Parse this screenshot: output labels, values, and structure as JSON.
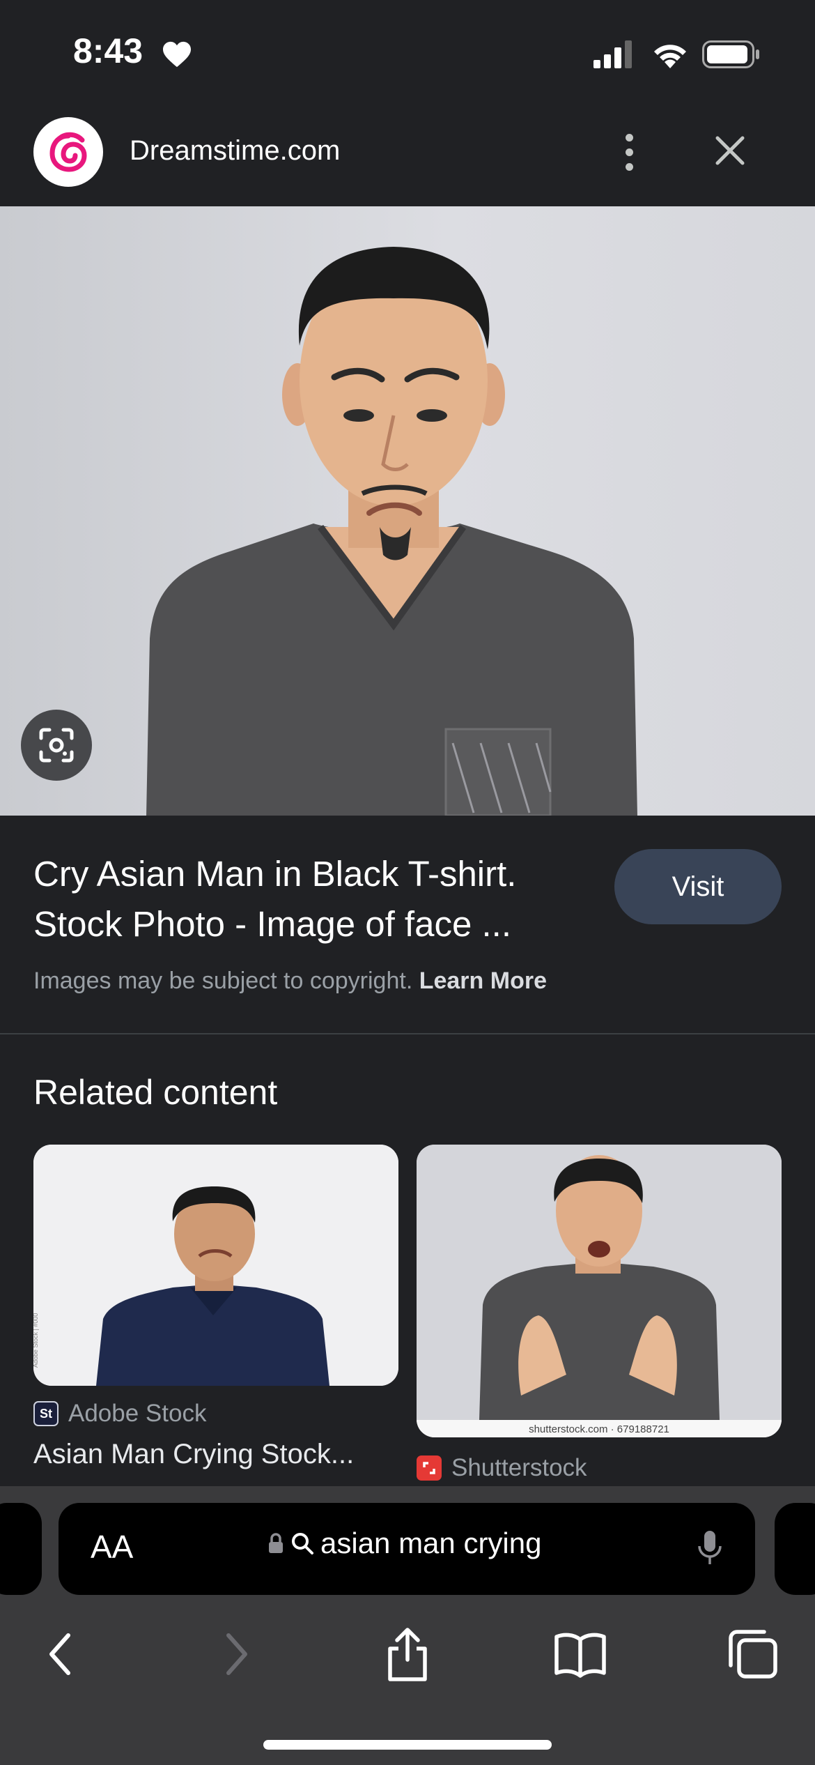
{
  "status_bar": {
    "time": "8:43"
  },
  "site": {
    "name": "Dreamstime.com"
  },
  "result": {
    "title": "Cry Asian Man in Black T-shirt. Stock Photo - Image of face ...",
    "visit_label": "Visit",
    "copyright_text": "Images may be subject to copyright.",
    "learn_more_label": "Learn More"
  },
  "related": {
    "heading": "Related content",
    "cards": [
      {
        "source": "Adobe Stock",
        "favicon_text": "St",
        "title": "Asian Man Crying Stock..."
      },
      {
        "source": "Shutterstock",
        "watermark": "shutterstock.com · 679188721"
      }
    ]
  },
  "browser": {
    "text_size_label": "AA",
    "search_query": "asian man crying"
  },
  "colors": {
    "background": "#202124",
    "visit_button": "#394457",
    "toolbar": "#3a3a3c",
    "brand_pink": "#e8177d"
  },
  "icons": {
    "status": [
      "heart-icon",
      "signal-icon",
      "wifi-icon",
      "battery-icon"
    ],
    "header": [
      "more-vert-icon",
      "close-icon"
    ],
    "image": [
      "lens-icon"
    ],
    "address": [
      "lock-icon",
      "search-icon",
      "mic-icon"
    ],
    "nav": [
      "back-icon",
      "forward-icon",
      "share-icon",
      "bookmarks-icon",
      "tabs-icon"
    ]
  }
}
